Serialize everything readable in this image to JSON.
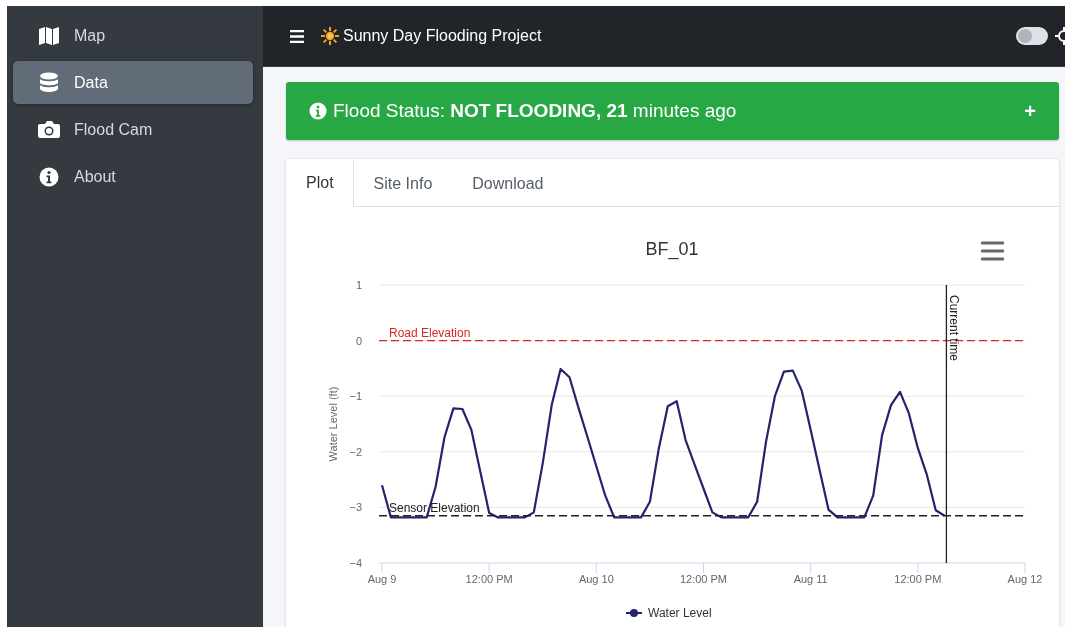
{
  "sidebar": {
    "items": [
      {
        "label": "Map",
        "selected": false
      },
      {
        "label": "Data",
        "selected": true
      },
      {
        "label": "Flood Cam",
        "selected": false
      },
      {
        "label": "About",
        "selected": false
      }
    ]
  },
  "topbar": {
    "title": "Sunny Day Flooding Project",
    "dark_mode_toggle": {
      "on": false
    }
  },
  "alert": {
    "text": "Flood Status: **NOT FLOODING, 21** minutes ago",
    "expand": "+"
  },
  "tabs": [
    {
      "label": "Plot",
      "selected": true
    },
    {
      "label": "Site Info",
      "selected": false
    },
    {
      "label": "Download",
      "selected": false
    }
  ],
  "chart": {
    "current_time": {
      "label": "Current time"
    },
    "chart_data": {
      "type": "line",
      "title": "BF_01",
      "ylabel": "Water Level (ft)",
      "categories": [
        "Aug 9",
        null,
        null,
        null,
        null,
        null,
        null,
        null,
        null,
        null,
        null,
        null,
        "12:00 PM",
        null,
        null,
        null,
        null,
        null,
        null,
        null,
        null,
        null,
        null,
        null,
        "Aug 10",
        null,
        null,
        null,
        null,
        null,
        null,
        null,
        null,
        null,
        null,
        null,
        "12:00 PM",
        null,
        null,
        null,
        null,
        null,
        null,
        null,
        null,
        null,
        null,
        null,
        "Aug 11",
        null,
        null,
        null,
        null,
        null,
        null,
        null,
        null,
        null,
        null,
        null,
        "12:00 PM",
        null,
        null,
        null,
        null,
        null,
        null,
        null,
        null,
        null,
        null,
        null,
        "Aug 12"
      ],
      "series": [
        {
          "name": "Water Level",
          "color": "#23236e",
          "values": [
            -2.6,
            -3.18,
            -3.18,
            -3.18,
            -3.18,
            -3.18,
            -2.63,
            -1.74,
            -1.22,
            -1.23,
            -1.6,
            -2.35,
            -3.1,
            -3.18,
            -3.18,
            -3.18,
            -3.18,
            -3.09,
            -2.2,
            -1.16,
            -0.51,
            -0.66,
            -1.21,
            -1.73,
            -2.26,
            -2.79,
            -3.18,
            -3.18,
            -3.18,
            -3.18,
            -2.9,
            -1.94,
            -1.18,
            -1.09,
            -1.79,
            -2.23,
            -2.66,
            -3.09,
            -3.18,
            -3.18,
            -3.18,
            -3.18,
            -2.9,
            -1.82,
            -1.0,
            -0.56,
            -0.54,
            -0.9,
            -1.61,
            -2.33,
            -3.04,
            -3.18,
            -3.18,
            -3.18,
            -3.18,
            -2.79,
            -1.7,
            -1.16,
            -0.92,
            -1.31,
            -1.93,
            -2.41,
            -3.05,
            -3.15,
            null,
            null,
            null,
            null,
            null,
            null,
            null,
            null,
            null
          ]
        }
      ],
      "ylim": [
        -4,
        1
      ],
      "grid": true,
      "yticks": [
        {
          "value": 1,
          "label": "1"
        },
        {
          "value": 0,
          "label": "0"
        },
        {
          "value": -1,
          "label": "−1"
        },
        {
          "value": -2,
          "label": "−2"
        },
        {
          "value": -3,
          "label": "−3"
        },
        {
          "value": -4,
          "label": "−4"
        }
      ],
      "ref_lines": [
        {
          "axis": "y",
          "value": 0,
          "label": "Road Elevation",
          "color": "#d62728"
        },
        {
          "axis": "y",
          "value": -3.15,
          "label": "Sensor Elevation",
          "color": "#222222"
        }
      ]
    }
  }
}
